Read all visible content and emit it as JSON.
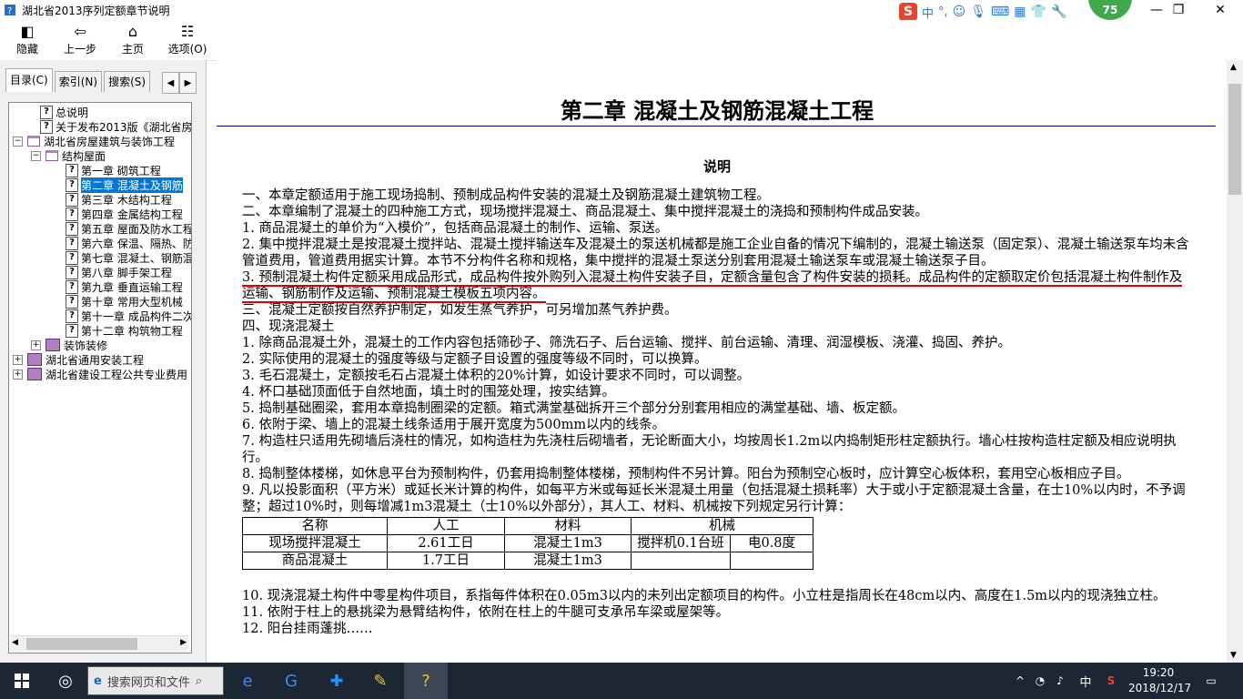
{
  "window": {
    "title": "湖北省2013序列定额章节说明",
    "minimize": "—",
    "restore": "❐",
    "close": "✕"
  },
  "ime": {
    "mode": "中",
    "dot": "°,",
    "badge": "75"
  },
  "toolbar": {
    "hide": "隐藏",
    "back": "上一步",
    "home": "主页",
    "options": "选项(O)"
  },
  "tabs": {
    "contents": "目录(C)",
    "index": "索引(N)",
    "search": "搜索(S)"
  },
  "tree": [
    {
      "label": "总说明",
      "type": "doc",
      "level": 1
    },
    {
      "label": "关于发布2013版《湖北省房屋",
      "type": "doc",
      "level": 1
    },
    {
      "label": "湖北省房屋建筑与装饰工程",
      "type": "openbook",
      "level": 0,
      "exp": "−"
    },
    {
      "label": "结构屋面",
      "type": "openbook",
      "level": 1,
      "exp": "−"
    },
    {
      "label": "第一章  砌筑工程",
      "type": "doc",
      "level": 2
    },
    {
      "label": "第二章  混凝土及钢筋",
      "type": "doc",
      "level": 2,
      "selected": true
    },
    {
      "label": "第三章  木结构工程",
      "type": "doc",
      "level": 2
    },
    {
      "label": "第四章  金属结构工程",
      "type": "doc",
      "level": 2
    },
    {
      "label": "第五章  屋面及防水工程",
      "type": "doc",
      "level": 2
    },
    {
      "label": "第六章  保温、隔热、防",
      "type": "doc",
      "level": 2
    },
    {
      "label": "第七章  混凝土、钢筋混",
      "type": "doc",
      "level": 2
    },
    {
      "label": "第八章  脚手架工程",
      "type": "doc",
      "level": 2
    },
    {
      "label": "第九章  垂直运输工程",
      "type": "doc",
      "level": 2
    },
    {
      "label": "第十章  常用大型机械",
      "type": "doc",
      "level": 2
    },
    {
      "label": "第十一章  成品构件二次",
      "type": "doc",
      "level": 2
    },
    {
      "label": "第十二章  构筑物工程",
      "type": "doc",
      "level": 2
    },
    {
      "label": "装饰装修",
      "type": "book",
      "level": 1,
      "exp": "+"
    },
    {
      "label": "湖北省通用安装工程",
      "type": "book",
      "level": 0,
      "exp": "+"
    },
    {
      "label": "湖北省建设工程公共专业费用",
      "type": "book",
      "level": 0,
      "exp": "+"
    }
  ],
  "content": {
    "chapter": "第二章  混凝土及钢筋混凝土工程",
    "subtitle": "说明",
    "p1": "一、本章定额适用于施工现场捣制、预制成品构件安装的混凝土及钢筋混凝土建筑物工程。",
    "p2": "二、本章编制了混凝土的四种施工方式，现场搅拌混凝土、商品混凝土、集中搅拌混凝土的浇捣和预制构件成品安装。",
    "p3": "1. 商品混凝土的单价为“入模价”，包括商品混凝土的制作、运输、泵送。",
    "p4": "2. 集中搅拌混凝土是按混凝土搅拌站、混凝土搅拌输送车及混凝土的泵送机械都是施工企业自备的情况下编制的，混凝土输送泵（固定泵）、混凝土输送泵车均未含管道费用，管道费用据实计算。本节不分构件名称和规格，集中搅拌的混凝土泵送分别套用混凝土输送泵车或混凝土输送泵子目。",
    "p5": "3. 预制混凝土构件定额采用成品形式，成品构件按外购列入混凝土构件安装子目，定额含量包含了构件安装的损耗。成品构件的定额取定价包括混凝土构件制作及运输、钢筋制作及运输、预制混凝土模板五项内容。",
    "p6": "三、混凝土定额按自然养护制定，如发生蒸气养护，可另增加蒸气养护费。",
    "p7": "四、现浇混凝土",
    "p8": "1. 除商品混凝土外，混凝土的工作内容包括筛砂子、筛洗石子、后台运输、搅拌、前台运输、清理、润湿模板、浇灌、捣固、养护。",
    "p9": "2. 实际使用的混凝土的强度等级与定额子目设置的强度等级不同时，可以换算。",
    "p10": "3. 毛石混凝土，定额按毛石占混凝土体积的20%计算，如设计要求不同时，可以调整。",
    "p11": "4. 杯口基础顶面低于自然地面，填土时的围笼处理，按实结算。",
    "p12": "5. 捣制基础圈梁，套用本章捣制圈梁的定额。箱式满堂基础拆开三个部分分别套用相应的满堂基础、墙、板定额。",
    "p13": "6. 依附于梁、墙上的混凝土线条适用于展开宽度为500mm以内的线条。",
    "p14": "7. 构造柱只适用先砌墙后浇柱的情况，如构造柱为先浇柱后砌墙者，无论断面大小，均按周长1.2m以内捣制矩形柱定额执行。墙心柱按构造柱定额及相应说明执行。",
    "p15": "8. 捣制整体楼梯，如休息平台为预制构件，仍套用捣制整体楼梯，预制构件不另计算。阳台为预制空心板时，应计算空心板体积，套用空心板相应子目。",
    "p16": "9. 凡以投影面积（平方米）或延长米计算的构件，如每平方米或每延长米混凝土用量（包括混凝土损耗率）大于或小于定额混凝土含量，在士10%以内时，不予调整；超过10%时，则每增减1m3混凝土（士10%以外部分），其人工、材料、机械按下列规定另行计算：",
    "table": {
      "headers": [
        "名称",
        "人工",
        "材料",
        "机械"
      ],
      "rows": [
        [
          "现场搅拌混凝土",
          "2.61工日",
          "混凝土1m3",
          "搅拌机0.1台班",
          "电0.8度"
        ],
        [
          "商品混凝土",
          "1.7工日",
          "混凝土1m3",
          "",
          ""
        ]
      ]
    },
    "p17": "10. 现浇混凝土构件中零星构件项目，系指每件体积在0.05m3以内的未列出定额项目的构件。小立柱是指周长在48cm以内、高度在1.5m以内的现浇独立柱。",
    "p18": "11. 依附于柱上的悬挑梁为悬臂结构件，依附在柱上的牛腿可支承吊车梁或屋架等。",
    "p19": "12. 阳台挂雨蓬挑……"
  },
  "taskbar": {
    "search_placeholder": "搜索网页和文件",
    "ime": "中",
    "time": "19:20",
    "date": "2018/12/17"
  }
}
